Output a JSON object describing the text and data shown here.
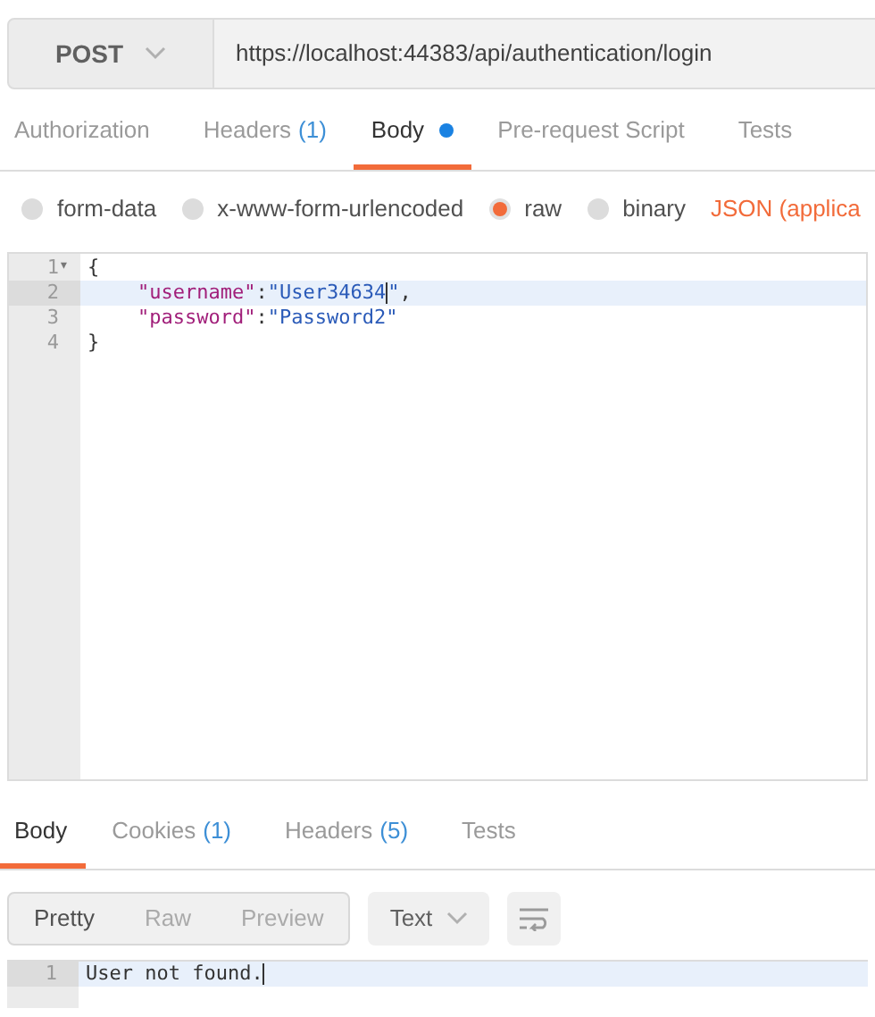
{
  "request": {
    "method": "POST",
    "url": "https://localhost:44383/api/authentication/login"
  },
  "request_tabs": [
    {
      "label": "Authorization",
      "selected": false,
      "modified": false
    },
    {
      "label": "Headers",
      "count": "(1)",
      "selected": false,
      "modified": false
    },
    {
      "label": "Body",
      "selected": true,
      "modified": true
    },
    {
      "label": "Pre-request Script",
      "selected": false,
      "modified": false
    },
    {
      "label": "Tests",
      "selected": false,
      "modified": false
    }
  ],
  "body_modes": [
    {
      "label": "form-data",
      "selected": false
    },
    {
      "label": "x-www-form-urlencoded",
      "selected": false
    },
    {
      "label": "raw",
      "selected": true
    },
    {
      "label": "binary",
      "selected": false
    }
  ],
  "content_type": "JSON (applica",
  "editor": {
    "lines": [
      {
        "number": "1",
        "fold": "▾",
        "active": false,
        "segments": [
          {
            "kind": "punct",
            "text": "{"
          }
        ]
      },
      {
        "number": "2",
        "active": true,
        "indent": true,
        "segments": [
          {
            "kind": "key",
            "text": "\"username\""
          },
          {
            "kind": "punct",
            "text": ":"
          },
          {
            "kind": "string",
            "text": "\"User34634"
          },
          {
            "kind": "caret"
          },
          {
            "kind": "string",
            "text": "\""
          },
          {
            "kind": "punct",
            "text": ","
          }
        ]
      },
      {
        "number": "3",
        "active": false,
        "indent": true,
        "segments": [
          {
            "kind": "key",
            "text": "\"password\""
          },
          {
            "kind": "punct",
            "text": ":"
          },
          {
            "kind": "string",
            "text": "\"Password2\""
          }
        ]
      },
      {
        "number": "4",
        "active": false,
        "segments": [
          {
            "kind": "punct",
            "text": "}"
          }
        ]
      }
    ]
  },
  "response_tabs": [
    {
      "label": "Body",
      "selected": true
    },
    {
      "label": "Cookies",
      "count": "(1)",
      "selected": false
    },
    {
      "label": "Headers",
      "count": "(5)",
      "selected": false
    },
    {
      "label": "Tests",
      "selected": false
    }
  ],
  "view_modes": [
    {
      "label": "Pretty",
      "selected": true
    },
    {
      "label": "Raw",
      "selected": false
    },
    {
      "label": "Preview",
      "selected": false
    }
  ],
  "format": "Text",
  "response": {
    "lines": [
      {
        "number": "1",
        "active": true,
        "segments": [
          {
            "kind": "plain",
            "text": "User not found."
          },
          {
            "kind": "caret"
          }
        ]
      }
    ]
  }
}
